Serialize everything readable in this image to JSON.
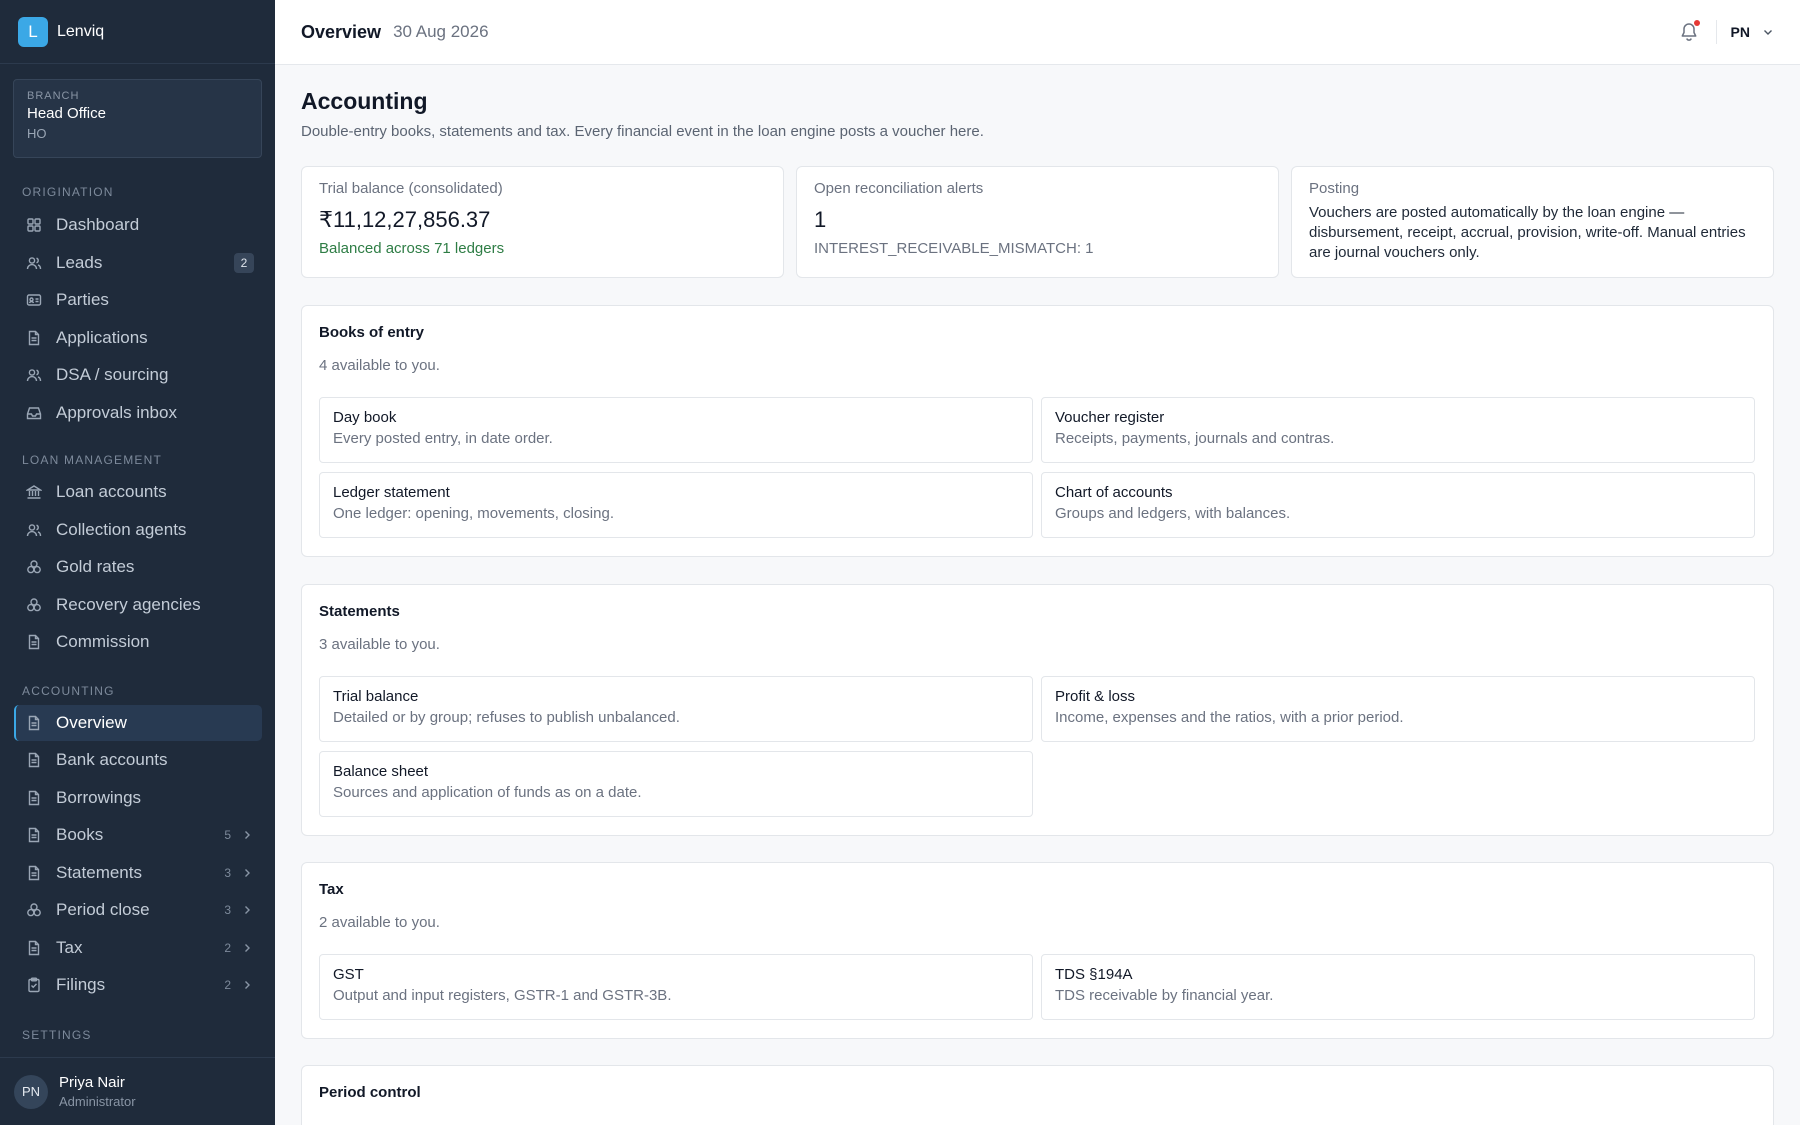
{
  "brand": {
    "logo_letter": "L",
    "name": "Lenviq"
  },
  "branch": {
    "label": "BRANCH",
    "name": "Head Office",
    "code": "HO"
  },
  "sidebar": {
    "origination_head": "ORIGINATION",
    "origination": [
      {
        "label": "Dashboard",
        "icon": "grid-icon"
      },
      {
        "label": "Leads",
        "icon": "users-icon",
        "badge": "2"
      },
      {
        "label": "Parties",
        "icon": "id-card-icon"
      },
      {
        "label": "Applications",
        "icon": "document-icon"
      },
      {
        "label": "DSA / sourcing",
        "icon": "users-icon"
      },
      {
        "label": "Approvals inbox",
        "icon": "inbox-icon"
      }
    ],
    "loan_head": "LOAN MANAGEMENT",
    "loan": [
      {
        "label": "Loan accounts",
        "icon": "bank-icon"
      },
      {
        "label": "Collection agents",
        "icon": "users-icon"
      },
      {
        "label": "Gold rates",
        "icon": "coins-icon"
      },
      {
        "label": "Recovery agencies",
        "icon": "coins-icon"
      },
      {
        "label": "Commission",
        "icon": "document-icon"
      }
    ],
    "accounting_head": "ACCOUNTING",
    "accounting": [
      {
        "label": "Overview",
        "icon": "document-icon"
      },
      {
        "label": "Bank accounts",
        "icon": "document-icon"
      },
      {
        "label": "Borrowings",
        "icon": "document-icon"
      },
      {
        "label": "Books",
        "icon": "document-icon",
        "count": "5"
      },
      {
        "label": "Statements",
        "icon": "document-icon",
        "count": "3"
      },
      {
        "label": "Period close",
        "icon": "coins-icon",
        "count": "3"
      },
      {
        "label": "Tax",
        "icon": "document-icon",
        "count": "2"
      },
      {
        "label": "Filings",
        "icon": "clipboard-icon",
        "count": "2"
      }
    ],
    "settings_head": "SETTINGS"
  },
  "user": {
    "initials": "PN",
    "name": "Priya Nair",
    "role": "Administrator"
  },
  "topbar": {
    "title": "Overview",
    "date": "30 Aug 2026",
    "initials": "PN"
  },
  "page": {
    "title": "Accounting",
    "subtitle": "Double-entry books, statements and tax. Every financial event in the loan engine posts a voucher here."
  },
  "stats": {
    "trial": {
      "label": "Trial balance (consolidated)",
      "value": "₹11,12,27,856.37",
      "note": "Balanced across 71 ledgers"
    },
    "recon": {
      "label": "Open reconciliation alerts",
      "value": "1",
      "note": "INTEREST_RECEIVABLE_MISMATCH: 1"
    },
    "posting": {
      "label": "Posting",
      "text": "Vouchers are posted automatically by the loan engine — disbursement, receipt, accrual, provision, write-off. Manual entries are journal vouchers only."
    }
  },
  "books": {
    "title": "Books of entry",
    "sub": "4 available to you.",
    "cards": [
      {
        "title": "Day book",
        "desc": "Every posted entry, in date order."
      },
      {
        "title": "Voucher register",
        "desc": "Receipts, payments, journals and contras."
      },
      {
        "title": "Ledger statement",
        "desc": "One ledger: opening, movements, closing."
      },
      {
        "title": "Chart of accounts",
        "desc": "Groups and ledgers, with balances."
      }
    ]
  },
  "statements": {
    "title": "Statements",
    "sub": "3 available to you.",
    "cards": [
      {
        "title": "Trial balance",
        "desc": "Detailed or by group; refuses to publish unbalanced."
      },
      {
        "title": "Profit & loss",
        "desc": "Income, expenses and the ratios, with a prior period."
      },
      {
        "title": "Balance sheet",
        "desc": "Sources and application of funds as on a date."
      }
    ]
  },
  "tax": {
    "title": "Tax",
    "sub": "2 available to you.",
    "cards": [
      {
        "title": "GST",
        "desc": "Output and input registers, GSTR-1 and GSTR-3B."
      },
      {
        "title": "TDS §194A",
        "desc": "TDS receivable by financial year."
      }
    ]
  },
  "period": {
    "title": "Period control"
  },
  "colors": {
    "sidebar": "#1f2b3b",
    "accent": "#3ba8e6",
    "success": "#2e7d45",
    "alert": "#e53935"
  }
}
